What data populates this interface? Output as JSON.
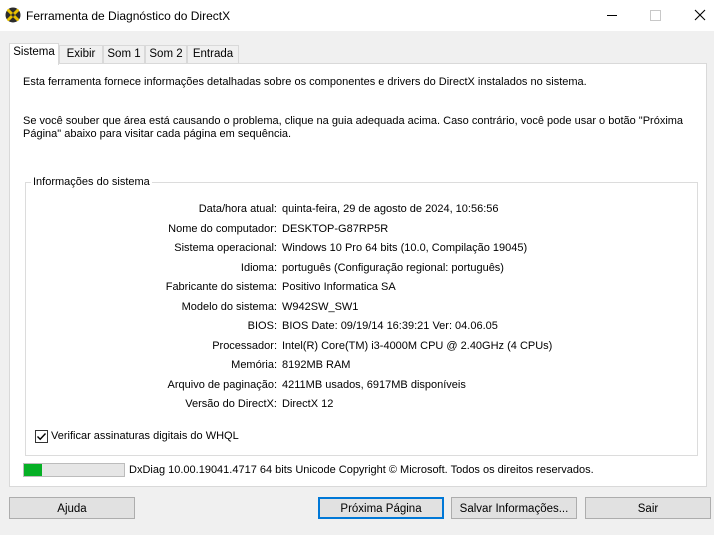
{
  "window": {
    "title": "Ferramenta de Diagnóstico do DirectX"
  },
  "tabs": [
    "Sistema",
    "Exibir",
    "Som 1",
    "Som 2",
    "Entrada"
  ],
  "active_tab": "Sistema",
  "intro": {
    "line1": "Esta ferramenta fornece informações detalhadas sobre os componentes e drivers do DirectX instalados no sistema.",
    "line2": "Se você souber que área está causando o problema, clique na guia adequada acima. Caso contrário, você pode usar o botão \"Próxima Página\" abaixo para visitar cada página em sequência."
  },
  "system_info": {
    "title": "Informações do sistema",
    "rows": [
      {
        "label": "Data/hora atual:",
        "value": "quinta-feira, 29 de agosto de 2024, 10:56:56"
      },
      {
        "label": "Nome do computador:",
        "value": "DESKTOP-G87RP5R"
      },
      {
        "label": "Sistema operacional:",
        "value": "Windows 10 Pro 64 bits (10.0, Compilação 19045)"
      },
      {
        "label": "Idioma:",
        "value": "português (Configuração regional: português)"
      },
      {
        "label": "Fabricante do sistema:",
        "value": "Positivo Informatica SA"
      },
      {
        "label": "Modelo do sistema:",
        "value": "W942SW_SW1"
      },
      {
        "label": "BIOS:",
        "value": "BIOS Date: 09/19/14 16:39:21 Ver: 04.06.05"
      },
      {
        "label": "Processador:",
        "value": "Intel(R) Core(TM) i3-4000M CPU @ 2.40GHz (4 CPUs)"
      },
      {
        "label": "Memória:",
        "value": "8192MB RAM"
      },
      {
        "label": "Arquivo de paginação:",
        "value": "4211MB usados, 6917MB disponíveis"
      },
      {
        "label": "Versão do DirectX:",
        "value": "DirectX 12"
      }
    ]
  },
  "whql": {
    "label": "Verificar assinaturas digitais do WHQL",
    "checked": true
  },
  "status": {
    "progress_fraction": 0.18,
    "progress_color": "#06b025",
    "text": "DxDiag 10.00.19041.4717 64 bits Unicode  Copyright © Microsoft. Todos os direitos reservados."
  },
  "buttons": {
    "help": "Ajuda",
    "next": "Próxima Página",
    "save": "Salvar Informações...",
    "exit": "Sair"
  },
  "icons": {
    "app": "directx-icon",
    "minimize": "minimize-icon",
    "maximize": "maximize-icon",
    "close": "close-icon",
    "check": "check-icon"
  }
}
